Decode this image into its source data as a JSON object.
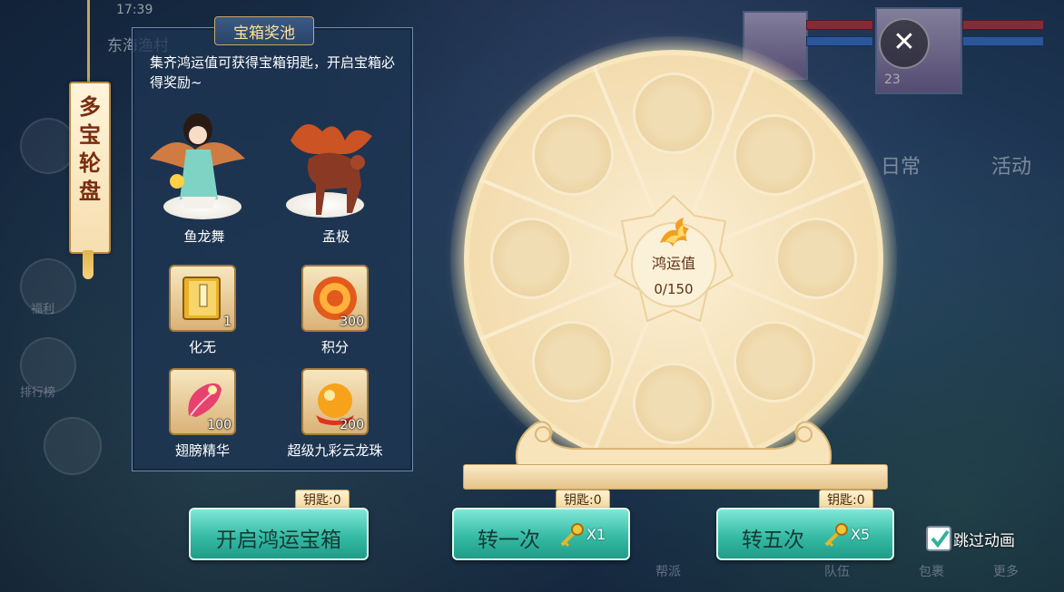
{
  "status": {
    "time": "17:39"
  },
  "background": {
    "map_name": "东海渔村",
    "tabs": [
      "日常",
      "活动"
    ],
    "side_labels": [
      "福利",
      "排行榜"
    ],
    "bottom_menu": [
      "帮派",
      "队伍",
      "包裹",
      "更多"
    ],
    "player_level": "23"
  },
  "banner": {
    "title": "多宝轮盘"
  },
  "prize_panel": {
    "title": "宝箱奖池",
    "description": "集齐鸿运值可获得宝箱钥匙，开启宝箱必得奖励~",
    "featured": [
      {
        "name": "鱼龙舞",
        "icon": "character-figure"
      },
      {
        "name": "孟极",
        "icon": "fire-beast-mount"
      }
    ],
    "items": [
      {
        "name": "化无",
        "count": "1",
        "icon": "book-icon"
      },
      {
        "name": "积分",
        "count": "300",
        "icon": "points-medal-icon"
      },
      {
        "name": "翅膀精华",
        "count": "100",
        "icon": "feather-icon"
      },
      {
        "name": "超级九彩云龙珠",
        "count": "200",
        "icon": "dragon-orb-icon"
      }
    ]
  },
  "wheel": {
    "slot_count": 8,
    "hub_label": "鸿运值",
    "progress_text": "0/150",
    "progress": 0
  },
  "buttons": {
    "open_chest": {
      "label": "开启鸿运宝箱",
      "key_tag": "钥匙:0"
    },
    "spin_once": {
      "label": "转一次",
      "multiplier": "X1",
      "key_tag": "钥匙:0"
    },
    "spin_five": {
      "label": "转五次",
      "multiplier": "X5",
      "key_tag": "钥匙:0"
    }
  },
  "skip_animation": {
    "label": "跳过动画",
    "checked": true
  },
  "colors": {
    "button": "#36bba5",
    "panel": "#1e3452",
    "wheel": "#f3dcae",
    "accent_gold": "#ffe09a"
  }
}
